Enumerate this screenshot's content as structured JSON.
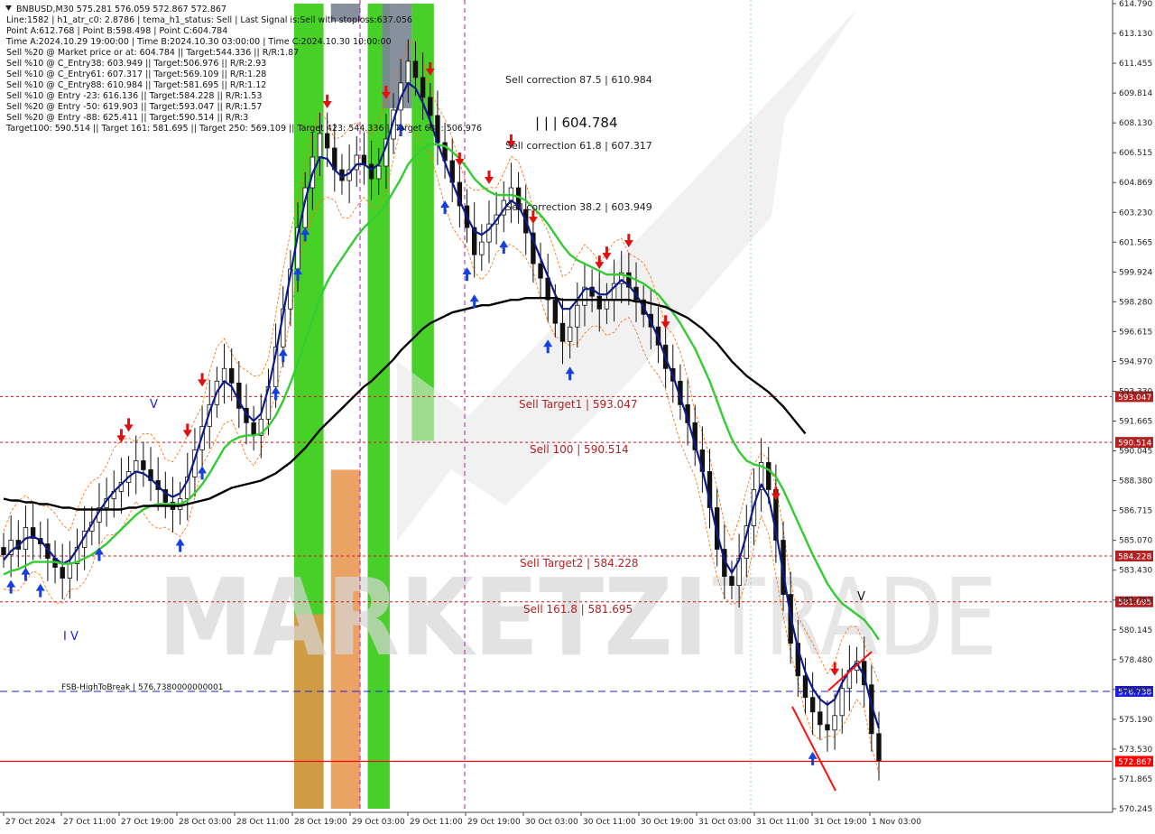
{
  "header": {
    "lines": [
      "BNBUSD,M30  575.281 576.059 572.867 572.867",
      "Line:1582 | h1_atr_c0: 2.8786 | tema_h1_status: Sell | Last Signal is:Sell with stoploss:637.056",
      "Point A:612.768 | Point B:598.498 | Point C:604.784",
      "Time A:2024.10.29 19:00:00 | Time B:2024.10.30 03:00:00 | Time C:2024.10.30 10:00:00",
      "Sell %20 @ Market price or at: 604.784 || Target:544.336 || R/R:1.87",
      "Sell %10 @ C_Entry38: 603.949 || Target:506.976 || R/R:2.93",
      "Sell %10 @ C_Entry61: 607.317 || Target:569.109 || R/R:1.28",
      "Sell %10 @ C_Entry88: 610.984 || Target:581.695 || R/R:1.12",
      "Sell %10 @ Entry -23: 616.136 || Target:584.228 || R/R:1.53",
      "Sell %20 @ Entry -50: 619.903 || Target:593.047 || R/R:1.57",
      "Sell %20 @ Entry -88: 625.411 || Target:590.514 || R/R:3",
      "Target100: 590.514 || Target 161: 581.695 || Target 250: 569.109 || Target 423: 544.336 || Target 685: 506.976"
    ]
  },
  "watermark": {
    "text_bold": "MARKETZI",
    "text_light": "TRADE"
  },
  "annotations": {
    "sell_corr_875": "Sell correction 87.5 | 610.984",
    "point_c": "| | | 604.784",
    "sell_corr_618": "Sell correction 61.8 | 607.317",
    "sell_corr_382": "Sell correction 38.2 | 603.949",
    "sell_target1": "Sell Target1 | 593.047",
    "sell_100": "Sell 100 | 590.514",
    "sell_target2": "Sell Target2 | 584.228",
    "sell_1618": "Sell 161.8 | 581.695",
    "fsb": "FSB-HighToBreak | 576.7380000000001",
    "wave_v_left": "V",
    "wave_iv": "I V",
    "wave_v_right": "V"
  },
  "colors": {
    "background": "#ffffff",
    "tema_blue": "#0d1a8a",
    "ema_green": "#33cc33",
    "ema_black": "#000000",
    "level_red": "#b22222",
    "fsb_blue": "#1f1fd6",
    "current_red": "#ff0000",
    "zone_green": "#33cc11",
    "zone_orange": "#e8924a",
    "zone_gray": "#7a8594",
    "candle": "#111111",
    "envelope": "#ff6a00",
    "sell_arrow": "#e01010",
    "buy_arrow": "#1540e0"
  },
  "chart_data": {
    "type": "candlestick",
    "title": "BNBUSD,M30",
    "symbol": "BNBUSD",
    "timeframe": "M30",
    "ohlc_last": {
      "open": 575.281,
      "high": 576.059,
      "low": 572.867,
      "close": 572.867
    },
    "ylim": [
      570.245,
      614.79
    ],
    "y_ticks": [
      "614.790",
      "613.130",
      "611.455",
      "609.814",
      "608.130",
      "606.515",
      "604.869",
      "603.230",
      "601.565",
      "599.924",
      "598.280",
      "596.615",
      "594.970",
      "593.330",
      "591.665",
      "590.045",
      "588.380",
      "586.715",
      "585.070",
      "583.430",
      "581.765",
      "580.145",
      "578.480",
      "576.835",
      "575.190",
      "573.530",
      "571.865",
      "570.245"
    ],
    "x_ticks": [
      "27 Oct 2024",
      "27 Oct 11:00",
      "27 Oct 19:00",
      "28 Oct 03:00",
      "28 Oct 11:00",
      "28 Oct 19:00",
      "29 Oct 03:00",
      "29 Oct 11:00",
      "29 Oct 19:00",
      "30 Oct 03:00",
      "30 Oct 11:00",
      "30 Oct 19:00",
      "31 Oct 03:00",
      "31 Oct 11:00",
      "31 Oct 19:00",
      "1 Nov 03:00"
    ],
    "levels": [
      {
        "name": "Sell Target1",
        "value": 593.047,
        "label": "593.047",
        "style": "dashed",
        "color": "#b22222"
      },
      {
        "name": "Sell 100",
        "value": 590.514,
        "label": "590.514",
        "style": "dashed",
        "color": "#b22222"
      },
      {
        "name": "Sell Target2",
        "value": 584.228,
        "label": "584.228",
        "style": "dashed",
        "color": "#b22222"
      },
      {
        "name": "Sell 161.8",
        "value": 581.695,
        "label": "581.695",
        "style": "dashed",
        "color": "#b22222"
      },
      {
        "name": "FSB-HighToBreak",
        "value": 576.738,
        "label": "576.738",
        "style": "dashed",
        "color": "#1f1fd6"
      },
      {
        "name": "Current price",
        "value": 572.867,
        "label": "572.867",
        "style": "solid",
        "color": "#ff0000"
      }
    ],
    "closes": [
      584.3,
      585.1,
      584.6,
      585.8,
      585.2,
      584.9,
      584.1,
      583.6,
      583.0,
      583.8,
      584.7,
      585.6,
      586.1,
      586.9,
      587.4,
      587.8,
      588.3,
      588.9,
      589.5,
      589.0,
      588.4,
      587.9,
      587.2,
      586.8,
      587.4,
      588.6,
      590.1,
      591.4,
      592.6,
      593.9,
      594.6,
      593.8,
      592.4,
      591.6,
      590.9,
      591.8,
      593.6,
      595.8,
      597.9,
      600.1,
      602.4,
      604.6,
      606.3,
      607.6,
      606.8,
      605.6,
      605.0,
      605.6,
      606.4,
      605.9,
      605.1,
      605.8,
      607.3,
      608.9,
      610.4,
      611.6,
      610.7,
      609.6,
      608.6,
      607.1,
      606.1,
      604.9,
      603.6,
      602.4,
      600.9,
      601.6,
      602.6,
      603.1,
      603.9,
      604.6,
      603.4,
      602.1,
      600.4,
      599.6,
      598.4,
      597.1,
      596.1,
      596.9,
      598.1,
      599.1,
      598.6,
      597.9,
      598.4,
      599.3,
      599.9,
      599.1,
      598.4,
      597.6,
      596.9,
      595.9,
      594.6,
      593.9,
      592.6,
      591.6,
      590.1,
      588.9,
      586.9,
      584.6,
      583.1,
      582.6,
      584.1,
      585.9,
      587.9,
      589.4,
      587.9,
      585.1,
      582.1,
      579.4,
      577.6,
      576.4,
      575.6,
      574.9,
      574.6,
      575.4,
      576.9,
      577.9,
      578.4,
      577.1,
      574.4,
      572.9
    ],
    "series": [
      {
        "name": "TEMA",
        "values": [
          584.0,
          584.5,
          584.8,
          585.2,
          585.3,
          585.1,
          584.6,
          584.1,
          583.8,
          584.0,
          584.6,
          585.3,
          586.0,
          586.7,
          587.3,
          587.8,
          588.2,
          588.6,
          588.9,
          588.8,
          588.5,
          588.1,
          587.7,
          587.5,
          587.7,
          588.4,
          589.6,
          590.9,
          592.2,
          593.3,
          593.9,
          593.6,
          592.8,
          592.1,
          591.7,
          592.1,
          593.5,
          595.4,
          597.6,
          599.8,
          602.0,
          603.9,
          605.4,
          606.3,
          606.2,
          605.6,
          605.2,
          605.4,
          605.9,
          605.9,
          605.6,
          605.9,
          606.9,
          608.3,
          609.6,
          610.4,
          610.1,
          609.3,
          608.3,
          607.1,
          606.0,
          604.9,
          603.9,
          603.0,
          602.2,
          602.0,
          602.3,
          602.8,
          603.4,
          603.9,
          603.6,
          602.8,
          601.7,
          600.7,
          599.7,
          598.7,
          597.9,
          597.9,
          598.4,
          599.0,
          599.0,
          598.7,
          598.7,
          599.1,
          599.5,
          599.2,
          598.7,
          598.0,
          597.2,
          596.3,
          595.2,
          594.2,
          593.0,
          591.8,
          590.4,
          589.0,
          587.3,
          585.5,
          584.0,
          583.3,
          584.0,
          585.4,
          587.0,
          588.2,
          587.5,
          585.6,
          583.3,
          580.9,
          579.1,
          577.8,
          576.9,
          576.3,
          576.0,
          576.3,
          577.2,
          577.9,
          578.3,
          577.6,
          576.0,
          574.7
        ]
      },
      {
        "name": "EMA green",
        "values": [
          583.2,
          583.4,
          583.5,
          583.7,
          583.9,
          583.9,
          583.9,
          583.9,
          583.8,
          583.8,
          583.9,
          584.1,
          584.3,
          584.6,
          584.9,
          585.3,
          585.7,
          586.1,
          586.5,
          586.8,
          587.0,
          587.1,
          587.1,
          587.1,
          587.1,
          587.3,
          587.7,
          588.2,
          588.8,
          589.5,
          590.2,
          590.6,
          590.8,
          590.9,
          590.9,
          591.0,
          591.4,
          592.0,
          592.8,
          593.8,
          594.9,
          596.1,
          597.3,
          598.5,
          599.4,
          600.1,
          600.7,
          601.3,
          601.9,
          602.4,
          602.8,
          603.2,
          603.7,
          604.4,
          605.1,
          605.9,
          606.4,
          606.8,
          607.0,
          607.0,
          606.9,
          606.6,
          606.2,
          605.7,
          605.1,
          604.7,
          604.4,
          604.2,
          604.2,
          604.2,
          604.1,
          603.9,
          603.5,
          603.1,
          602.6,
          602.0,
          601.4,
          600.9,
          600.6,
          600.4,
          600.2,
          600.0,
          599.8,
          599.8,
          599.8,
          599.7,
          599.5,
          599.3,
          599.0,
          598.7,
          598.2,
          597.7,
          597.1,
          596.4,
          595.7,
          594.8,
          593.9,
          592.8,
          591.7,
          590.7,
          590.0,
          589.5,
          589.3,
          589.2,
          589.0,
          588.6,
          587.9,
          587.0,
          586.1,
          585.2,
          584.3,
          583.5,
          582.7,
          582.1,
          581.6,
          581.3,
          581.0,
          580.7,
          580.2,
          579.6
        ]
      },
      {
        "name": "EMA black",
        "values": [
          587.4,
          587.3,
          587.3,
          587.2,
          587.2,
          587.1,
          587.1,
          587.0,
          586.9,
          586.9,
          586.8,
          586.8,
          586.8,
          586.8,
          586.8,
          586.8,
          586.8,
          586.9,
          586.9,
          587.0,
          587.0,
          587.0,
          587.0,
          587.0,
          587.0,
          587.1,
          587.2,
          587.3,
          587.4,
          587.6,
          587.8,
          588.0,
          588.1,
          588.2,
          588.3,
          588.4,
          588.6,
          588.8,
          589.1,
          589.4,
          589.8,
          590.2,
          590.7,
          591.2,
          591.6,
          592.0,
          592.4,
          592.8,
          593.2,
          593.6,
          593.9,
          594.3,
          594.7,
          595.1,
          595.6,
          596.0,
          596.4,
          596.8,
          597.1,
          597.3,
          597.5,
          597.7,
          597.8,
          597.9,
          598.0,
          598.1,
          598.1,
          598.2,
          598.3,
          598.4,
          598.4,
          598.5,
          598.5,
          598.5,
          598.5,
          598.5,
          598.4,
          598.4,
          598.4,
          598.4,
          598.4,
          598.4,
          598.4,
          598.4,
          598.4,
          598.4,
          598.3,
          598.3,
          598.2,
          598.1,
          598.0,
          597.8,
          597.6,
          597.4,
          597.1,
          596.8,
          596.4,
          596.0,
          595.5,
          595.0,
          594.6,
          594.2,
          593.9,
          593.6,
          593.3,
          592.9,
          592.5,
          592.0,
          591.5,
          591.0
        ]
      }
    ],
    "zones": [
      {
        "color": "green",
        "from_index": 40,
        "to_index": 43,
        "top": 614.79,
        "bottom": 570.245
      },
      {
        "color": "orange",
        "from_index": 40,
        "to_index": 43,
        "top": 581.0,
        "bottom": 570.245
      },
      {
        "color": "gray",
        "from_index": 45,
        "to_index": 48,
        "top": 614.79,
        "bottom": 613.8
      },
      {
        "color": "orange",
        "from_index": 45,
        "to_index": 48,
        "top": 589.0,
        "bottom": 570.245
      },
      {
        "color": "green",
        "from_index": 50,
        "to_index": 52,
        "top": 614.79,
        "bottom": 570.245
      },
      {
        "color": "gray",
        "from_index": 52,
        "to_index": 55,
        "top": 614.79,
        "bottom": 609.0
      },
      {
        "color": "green",
        "from_index": 56,
        "to_index": 58,
        "top": 614.79,
        "bottom": 590.6
      }
    ],
    "sell_arrow_indices": [
      16,
      17,
      25,
      27,
      44,
      52,
      58,
      62,
      66,
      69,
      72,
      81,
      82,
      85,
      90,
      105,
      113
    ],
    "buy_arrow_indices": [
      1,
      3,
      5,
      13,
      24,
      27,
      37,
      38,
      40,
      41,
      54,
      60,
      63,
      64,
      68,
      74,
      77,
      110
    ]
  }
}
